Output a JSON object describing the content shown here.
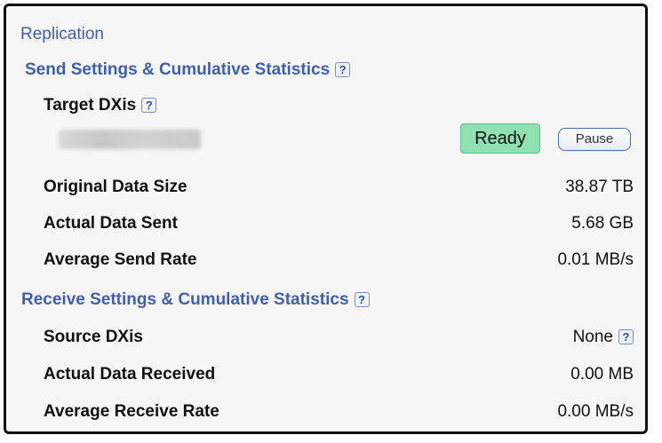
{
  "panel": {
    "title": "Replication"
  },
  "send": {
    "heading": "Send Settings & Cumulative Statistics",
    "target_label": "Target DXis",
    "target_status": "Ready",
    "pause_label": "Pause",
    "rows": [
      {
        "label": "Original Data Size",
        "value": "38.87 TB"
      },
      {
        "label": "Actual Data Sent",
        "value": "5.68 GB"
      },
      {
        "label": "Average Send Rate",
        "value": "0.01 MB/s"
      }
    ]
  },
  "receive": {
    "heading": "Receive Settings & Cumulative Statistics",
    "source_label": "Source DXis",
    "source_value": "None",
    "rows": [
      {
        "label": "Actual Data Received",
        "value": "0.00 MB"
      },
      {
        "label": "Average Receive Rate",
        "value": "0.00 MB/s"
      }
    ]
  },
  "help_glyph": "?",
  "colors": {
    "section_text": "#3f5fa8",
    "ready_bg": "#8fe0b3",
    "panel_bg": "#f6f6f6"
  }
}
